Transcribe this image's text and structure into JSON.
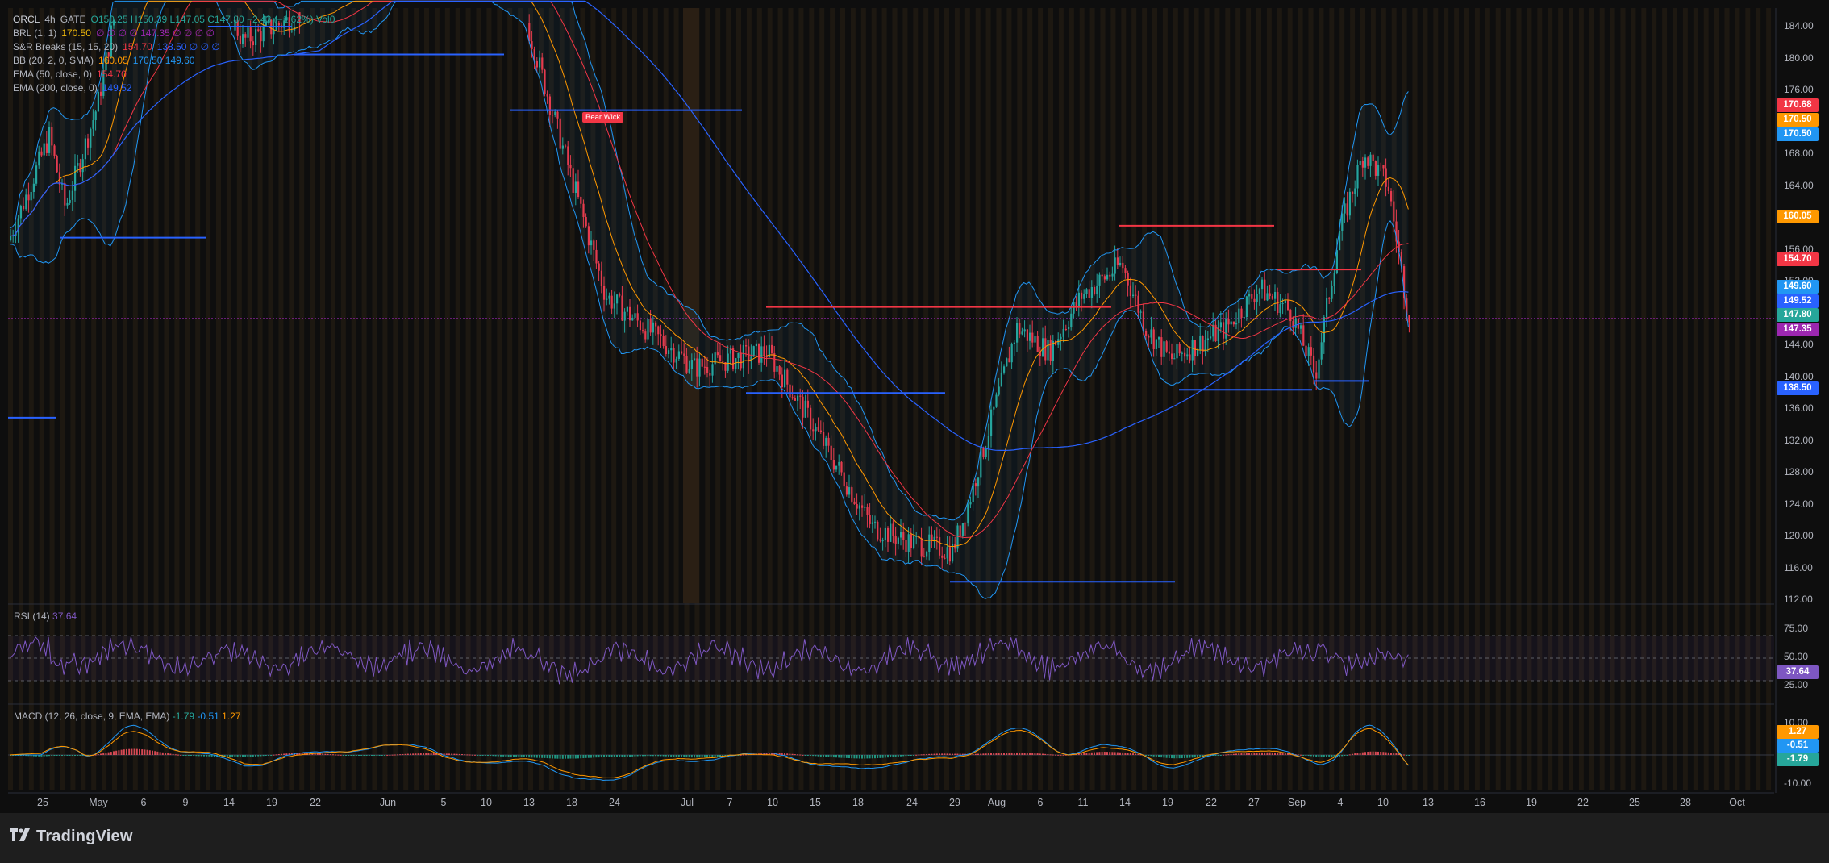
{
  "legend": {
    "symbol": "ORCL",
    "interval": "4h",
    "exchange": "GATE",
    "ohlc": "O150.25 H150.39 L147.05 C147.80 −2.43 (−1.62%) Vol0",
    "indicators": [
      {
        "name": "BRL (1, 1)",
        "value": "170.50",
        "extra": "∅ ∅ ∅ ∅ 147.35 ∅ ∅ ∅ ∅",
        "color": "#f0b90b"
      },
      {
        "name": "S&R Breaks (15, 15, 20)",
        "value": "154.70",
        "extra": "138.50 ∅ ∅ ∅",
        "color": "#f23645"
      },
      {
        "name": "BB (20, 2, 0, SMA)",
        "value": "160.05",
        "extra": "170.50 149.60",
        "color": "#ff9800"
      },
      {
        "name": "EMA (50, close, 0)",
        "value": "154.70",
        "extra": "",
        "color": "#f23645"
      },
      {
        "name": "EMA (200, close, 0)",
        "value": "149.52",
        "extra": "",
        "color": "#2962ff"
      }
    ]
  },
  "price_axis": {
    "ticks": [
      "184.00",
      "180.00",
      "176.00",
      "172.00",
      "168.00",
      "164.00",
      "160.00",
      "156.00",
      "152.00",
      "148.00",
      "144.00",
      "140.00",
      "136.00",
      "132.00",
      "128.00",
      "124.00",
      "120.00",
      "116.00",
      "112.00"
    ],
    "tags": [
      {
        "label": "170.68",
        "color": "#f23645"
      },
      {
        "label": "170.50",
        "color": "#ff9800"
      },
      {
        "label": "170.50",
        "color": "#2196f3"
      },
      {
        "label": "160.05",
        "color": "#ff9800"
      },
      {
        "label": "154.70",
        "color": "#f23645"
      },
      {
        "label": "149.60",
        "color": "#2196f3"
      },
      {
        "label": "149.52",
        "color": "#2962ff"
      },
      {
        "label": "147.80",
        "color": "#26a69a"
      },
      {
        "label": "147.35",
        "color": "#9c27b0"
      },
      {
        "label": "138.50",
        "color": "#2962ff"
      }
    ]
  },
  "annotations": {
    "bear_wick": "Bear Wick"
  },
  "rsi": {
    "title": "RSI (14)",
    "value": "37.64",
    "ticks": [
      "75.00",
      "50.00",
      "25.00"
    ],
    "tag": "37.64",
    "tag_color": "#7e57c2"
  },
  "macd": {
    "title": "MACD (12, 26, close, 9, EMA, EMA)",
    "values": [
      "-1.79",
      "-0.51",
      "1.27"
    ],
    "ticks": [
      "10.00",
      "-10.00"
    ],
    "tags": [
      {
        "label": "1.27",
        "color": "#ff9800"
      },
      {
        "label": "-0.51",
        "color": "#2196f3"
      },
      {
        "label": "-1.79",
        "color": "#26a69a"
      }
    ]
  },
  "time_axis": [
    "25",
    "May",
    "6",
    "9",
    "14",
    "19",
    "22",
    "Jun",
    "5",
    "10",
    "13",
    "18",
    "24",
    "Jul",
    "7",
    "10",
    "15",
    "18",
    "24",
    "29",
    "Aug",
    "6",
    "11",
    "14",
    "19",
    "22",
    "27",
    "Sep",
    "4",
    "10",
    "13",
    "16",
    "19",
    "22",
    "25",
    "28",
    "Oct"
  ],
  "branding": {
    "logo_text": "TradingView"
  },
  "colors": {
    "up": "#26a69a",
    "down": "#f23645",
    "bb": "#2196f3",
    "ema50": "#ff9800",
    "ema200": "#2962ff",
    "rsi": "#7e57c2"
  }
}
